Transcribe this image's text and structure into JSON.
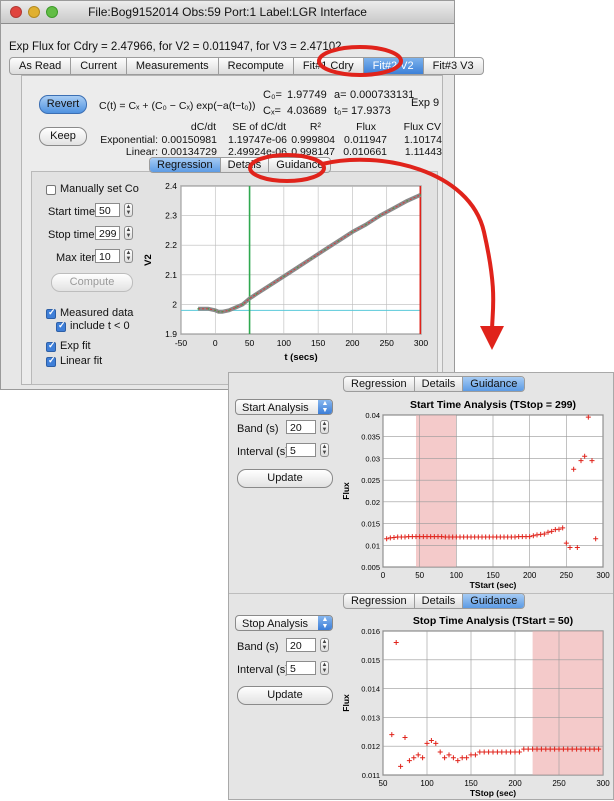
{
  "window": {
    "title": "File:Bog9152014  Obs:59  Port:1  Label:LGR Interface",
    "flux_title": "Exp Flux for Cdry = 2.47966, for V2 = 0.011947, for V3 = 2.47102"
  },
  "tabs": [
    "As Read",
    "Current",
    "Measurements",
    "Recompute",
    "Fit#1 Cdry",
    "Fit#2 V2",
    "Fit#3 V3"
  ],
  "selected_tab": "Fit#2 V2",
  "fit": {
    "revert_label": "Revert",
    "keep_label": "Keep",
    "equation": "C(t) = Cₓ + (C₀ − Cₓ) exp(−a(t−t₀))",
    "c0_label": "C₀=",
    "c0_value": "1.97749",
    "a_label": "a=",
    "a_value": "0.000733131",
    "cx_label": "Cₓ=",
    "cx_value": "4.03689",
    "t0_label": "t₀=",
    "t0_value": "17.9373",
    "exp_label": "Exp 9"
  },
  "stats_table": {
    "headers": [
      "dC/dt",
      "SE of dC/dt",
      "R²",
      "Flux",
      "Flux CV"
    ],
    "rows": [
      {
        "label": "Exponential:",
        "values": [
          "0.00150981",
          "1.19747e-06",
          "0.999804",
          "0.011947",
          "1.10174"
        ]
      },
      {
        "label": "Linear:",
        "values": [
          "0.00134729",
          "2.49924e-06",
          "0.998147",
          "0.010661",
          "1.11443"
        ]
      }
    ]
  },
  "subtabs": [
    "Regression",
    "Details",
    "Guidance"
  ],
  "controls": {
    "manual_co": "Manually set Co",
    "start_time_label": "Start time",
    "start_time_value": "50",
    "stop_time_label": "Stop time",
    "stop_time_value": "299",
    "max_iter_label": "Max iter",
    "max_iter_value": "10",
    "compute_label": "Compute",
    "measured_data": "Measured data",
    "include_neg": "include t < 0",
    "exp_fit": "Exp fit",
    "linear_fit": "Linear fit"
  },
  "guidance_start": {
    "dropdown": "Start Analysis",
    "band_label": "Band (s)",
    "band_value": "20",
    "interval_label": "Interval (s)",
    "interval_value": "5",
    "update_label": "Update"
  },
  "guidance_stop": {
    "dropdown": "Stop Analysis",
    "band_label": "Band (s)",
    "band_value": "20",
    "interval_label": "Interval (s)",
    "interval_value": "5",
    "update_label": "Update"
  },
  "colors": {
    "annotation": "#e0231b",
    "data": "#8a8a8a",
    "fit_line": "#d93a3a",
    "band": "#f0b8b8"
  },
  "chart_data": [
    {
      "type": "line",
      "ylabel": "V2",
      "xlabel": "t (secs)",
      "xlim": [
        -50,
        300
      ],
      "ylim": [
        1.9,
        2.4
      ],
      "xticks": [
        -50,
        0,
        50,
        100,
        150,
        200,
        250,
        300
      ],
      "yticks": [
        1.9,
        2,
        2.1,
        2.2,
        2.3,
        2.4
      ],
      "start_line": 50,
      "stop_line": 299,
      "baseline": 1.98,
      "series": [
        {
          "values_x": [
            -25,
            -10,
            0,
            5,
            10,
            20,
            30,
            40,
            50,
            60,
            80,
            100,
            120,
            140,
            160,
            180,
            200,
            220,
            240,
            260,
            280,
            299
          ],
          "values_y": [
            1.985,
            1.985,
            1.98,
            1.975,
            1.975,
            1.98,
            1.99,
            2.0,
            2.02,
            2.035,
            2.065,
            2.095,
            2.125,
            2.155,
            2.185,
            2.215,
            2.245,
            2.27,
            2.3,
            2.325,
            2.35,
            2.37
          ]
        }
      ]
    },
    {
      "type": "scatter",
      "title": "Start Time Analysis (TStop = 299)",
      "xlabel": "TStart (sec)",
      "ylabel": "Flux",
      "xlim": [
        0,
        300
      ],
      "ylim": [
        0.005,
        0.04
      ],
      "xticks": [
        0,
        50,
        100,
        150,
        200,
        250,
        300
      ],
      "yticks": [
        0.005,
        0.01,
        0.015,
        0.02,
        0.025,
        0.03,
        0.035,
        0.04
      ],
      "band": [
        45,
        100
      ],
      "x": [
        5,
        10,
        15,
        20,
        25,
        30,
        35,
        40,
        45,
        50,
        55,
        60,
        65,
        70,
        75,
        80,
        85,
        90,
        95,
        100,
        105,
        110,
        115,
        120,
        125,
        130,
        135,
        140,
        145,
        150,
        155,
        160,
        165,
        170,
        175,
        180,
        185,
        190,
        195,
        200,
        205,
        210,
        215,
        220,
        225,
        230,
        235,
        240,
        245,
        250,
        255,
        260,
        265,
        270,
        275,
        280,
        285,
        290
      ],
      "y": [
        0.0115,
        0.0117,
        0.0118,
        0.0119,
        0.0119,
        0.0119,
        0.012,
        0.012,
        0.012,
        0.012,
        0.012,
        0.012,
        0.012,
        0.012,
        0.012,
        0.012,
        0.0119,
        0.0119,
        0.0119,
        0.0119,
        0.0119,
        0.0119,
        0.0119,
        0.0119,
        0.0119,
        0.0119,
        0.0119,
        0.0119,
        0.0119,
        0.0119,
        0.0119,
        0.0119,
        0.0119,
        0.0119,
        0.0119,
        0.0119,
        0.012,
        0.012,
        0.012,
        0.012,
        0.0122,
        0.0124,
        0.0125,
        0.0126,
        0.013,
        0.0132,
        0.0136,
        0.0137,
        0.014,
        0.0105,
        0.0095,
        0.0275,
        0.0095,
        0.0295,
        0.0305,
        0.0395,
        0.0295,
        0.0115
      ]
    },
    {
      "type": "scatter",
      "title": "Stop Time Analysis (TStart = 50)",
      "xlabel": "TStop (sec)",
      "ylabel": "Flux",
      "xlim": [
        50,
        300
      ],
      "ylim": [
        0.011,
        0.016
      ],
      "xticks": [
        50,
        100,
        150,
        200,
        250,
        300
      ],
      "yticks": [
        0.011,
        0.012,
        0.013,
        0.014,
        0.015,
        0.016
      ],
      "band": [
        220,
        300
      ],
      "x": [
        60,
        65,
        70,
        75,
        80,
        85,
        90,
        95,
        100,
        105,
        110,
        115,
        120,
        125,
        130,
        135,
        140,
        145,
        150,
        155,
        160,
        165,
        170,
        175,
        180,
        185,
        190,
        195,
        200,
        205,
        210,
        215,
        220,
        225,
        230,
        235,
        240,
        245,
        250,
        255,
        260,
        265,
        270,
        275,
        280,
        285,
        290,
        295
      ],
      "y": [
        0.0124,
        0.0156,
        0.0113,
        0.0123,
        0.0115,
        0.0116,
        0.0117,
        0.0116,
        0.0121,
        0.0122,
        0.0121,
        0.0118,
        0.0116,
        0.0117,
        0.0116,
        0.0115,
        0.0116,
        0.0116,
        0.0117,
        0.0117,
        0.0118,
        0.0118,
        0.0118,
        0.0118,
        0.0118,
        0.0118,
        0.0118,
        0.0118,
        0.0118,
        0.0118,
        0.0119,
        0.0119,
        0.0119,
        0.0119,
        0.0119,
        0.0119,
        0.0119,
        0.0119,
        0.0119,
        0.0119,
        0.0119,
        0.0119,
        0.0119,
        0.0119,
        0.0119,
        0.0119,
        0.0119,
        0.0119
      ]
    }
  ]
}
